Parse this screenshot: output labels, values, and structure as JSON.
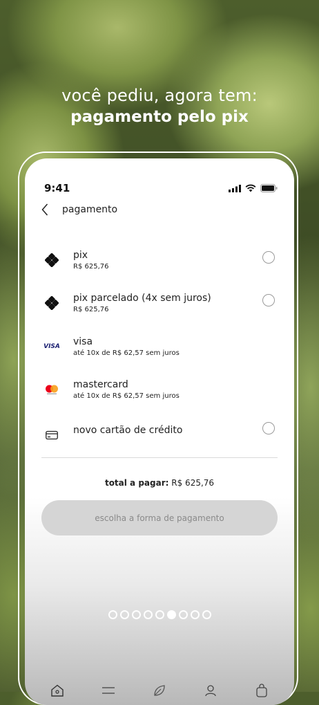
{
  "promo": {
    "line1": "você pediu, agora tem:",
    "line2": "pagamento pelo pix"
  },
  "status": {
    "time": "9:41",
    "icons": [
      "signal-icon",
      "wifi-icon",
      "battery-icon"
    ]
  },
  "nav": {
    "back_icon": "chevron-left-icon",
    "title": "pagamento"
  },
  "payment_options": [
    {
      "icon": "pix-icon",
      "name": "pix",
      "detail": "R$ 625,76",
      "has_radio": true
    },
    {
      "icon": "pix-icon",
      "name": "pix parcelado (4x sem juros)",
      "detail": "R$ 625,76",
      "has_radio": true
    },
    {
      "icon": "visa-icon",
      "icon_text": "VISA",
      "name": "visa",
      "detail": "até 10x de R$ 62,57 sem juros",
      "has_radio": false
    },
    {
      "icon": "mastercard-icon",
      "name": "mastercard",
      "detail": "até 10x de R$ 62,57 sem juros",
      "has_radio": false
    },
    {
      "icon": "credit-card-icon",
      "name": "novo cartão de crédito",
      "detail": "",
      "has_radio": true
    }
  ],
  "total": {
    "label": "total a pagar:",
    "value": "R$ 625,76"
  },
  "cta": {
    "label": "escolha a forma de pagamento"
  },
  "carousel": {
    "count": 9,
    "active_index": 5
  },
  "tabbar": {
    "icons": [
      "home-icon",
      "menu-icon",
      "leaf-icon",
      "profile-icon",
      "bag-icon"
    ]
  },
  "colors": {
    "accent_mastercard_red": "#eb001b",
    "accent_mastercard_yellow": "#f79e1b",
    "visa_blue": "#1a1f71",
    "button_disabled": "#d5d5d5"
  }
}
